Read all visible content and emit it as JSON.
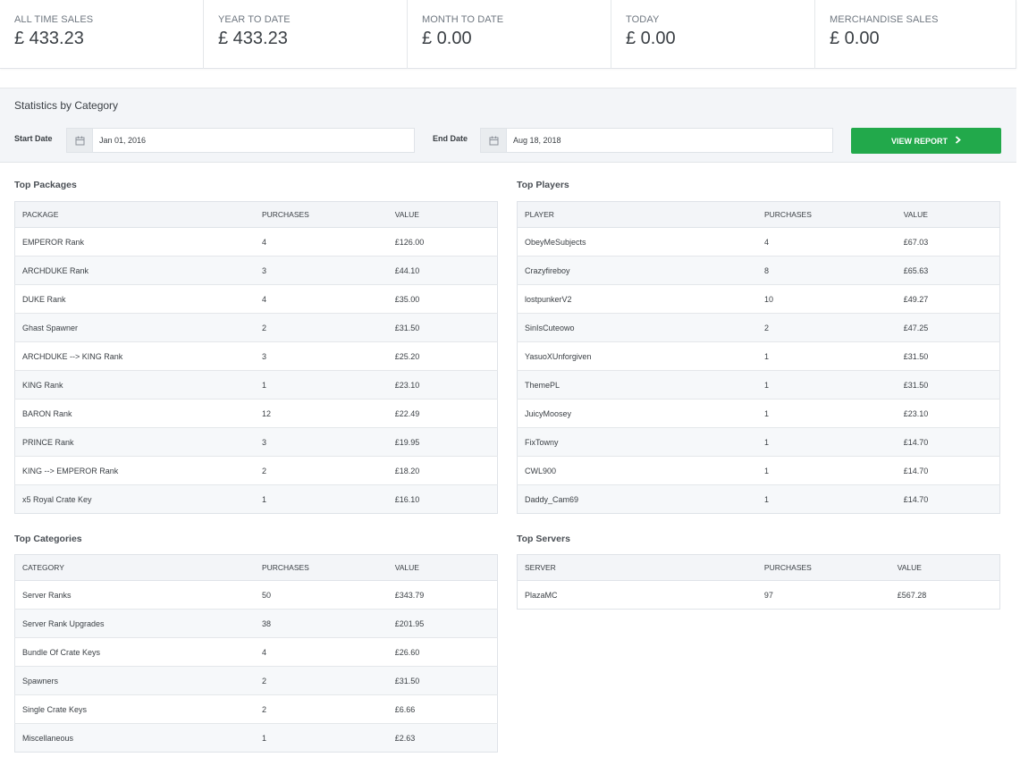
{
  "stats": [
    {
      "label": "ALL TIME SALES",
      "value": "£ 433.23"
    },
    {
      "label": "YEAR TO DATE",
      "value": "£ 433.23"
    },
    {
      "label": "MONTH TO DATE",
      "value": "£ 0.00"
    },
    {
      "label": "TODAY",
      "value": "£ 0.00"
    },
    {
      "label": "MERCHANDISE SALES",
      "value": "£ 0.00"
    }
  ],
  "filter": {
    "title": "Statistics by Category",
    "start_label": "Start Date",
    "start_value": "Jan 01, 2016",
    "end_label": "End Date",
    "end_value": "Aug 18, 2018",
    "button_label": "VIEW REPORT",
    "button_color": "#22a94b"
  },
  "top_packages": {
    "title": "Top Packages",
    "headers": [
      "PACKAGE",
      "PURCHASES",
      "VALUE"
    ],
    "rows": [
      [
        "EMPEROR Rank",
        "4",
        "£126.00"
      ],
      [
        "ARCHDUKE Rank",
        "3",
        "£44.10"
      ],
      [
        "DUKE Rank",
        "4",
        "£35.00"
      ],
      [
        "Ghast Spawner",
        "2",
        "£31.50"
      ],
      [
        "ARCHDUKE --> KING Rank",
        "3",
        "£25.20"
      ],
      [
        "KING Rank",
        "1",
        "£23.10"
      ],
      [
        "BARON Rank",
        "12",
        "£22.49"
      ],
      [
        "PRINCE Rank",
        "3",
        "£19.95"
      ],
      [
        "KING --> EMPEROR Rank",
        "2",
        "£18.20"
      ],
      [
        "x5 Royal Crate Key",
        "1",
        "£16.10"
      ]
    ]
  },
  "top_players": {
    "title": "Top Players",
    "headers": [
      "PLAYER",
      "PURCHASES",
      "VALUE"
    ],
    "rows": [
      [
        "ObeyMeSubjects",
        "4",
        "£67.03"
      ],
      [
        "Crazyfireboy",
        "8",
        "£65.63"
      ],
      [
        "lostpunkerV2",
        "10",
        "£49.27"
      ],
      [
        "SinIsCuteowo",
        "2",
        "£47.25"
      ],
      [
        "YasuoXUnforgiven",
        "1",
        "£31.50"
      ],
      [
        "ThemePL",
        "1",
        "£31.50"
      ],
      [
        "JuicyMoosey",
        "1",
        "£23.10"
      ],
      [
        "FixTowny",
        "1",
        "£14.70"
      ],
      [
        "CWL900",
        "1",
        "£14.70"
      ],
      [
        "Daddy_Cam69",
        "1",
        "£14.70"
      ]
    ]
  },
  "top_categories": {
    "title": "Top Categories",
    "headers": [
      "CATEGORY",
      "PURCHASES",
      "VALUE"
    ],
    "rows": [
      [
        "Server Ranks",
        "50",
        "£343.79"
      ],
      [
        "Server Rank Upgrades",
        "38",
        "£201.95"
      ],
      [
        "Bundle Of Crate Keys",
        "4",
        "£26.60"
      ],
      [
        "Spawners",
        "2",
        "£31.50"
      ],
      [
        "Single Crate Keys",
        "2",
        "£6.66"
      ],
      [
        "Miscellaneous",
        "1",
        "£2.63"
      ]
    ]
  },
  "top_servers": {
    "title": "Top Servers",
    "headers": [
      "SERVER",
      "PURCHASES",
      "VALUE"
    ],
    "rows": [
      [
        "PlazaMC",
        "97",
        "£567.28"
      ]
    ]
  },
  "icons": {
    "calendar": "calendar-icon",
    "chevron": "chevron-right-icon"
  }
}
